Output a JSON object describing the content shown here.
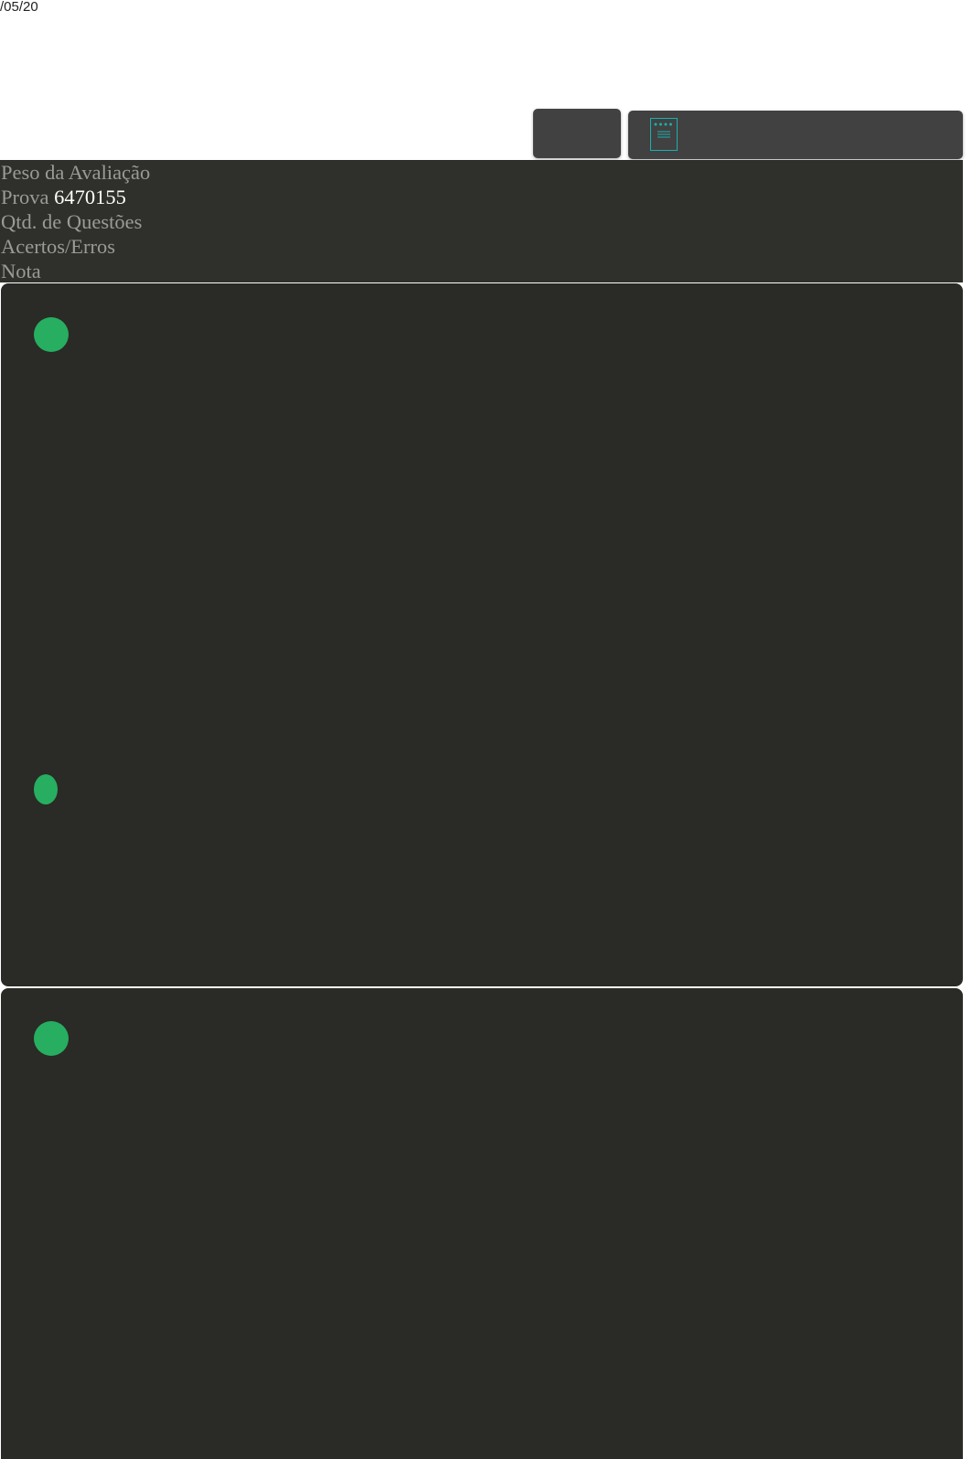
{
  "header": {
    "date_fragment": "/05/20"
  },
  "info": {
    "peso_label": "Peso da Avaliação",
    "prova_label": "Prova",
    "prova_value": "6470155",
    "qtd_label": "Qtd. de Questões",
    "acertos_label": "Acertos/Erros",
    "nota_label": "Nota"
  },
  "icons": {
    "document": "document-icon",
    "status": "check-circle-icon"
  },
  "colors": {
    "background": "#ffffff",
    "panel": "#414141",
    "info_block": "#2f2f2b",
    "card": "#2a2a26",
    "label_text": "#9a9a96",
    "value_text": "#ffffff",
    "status_green": "#27ae60",
    "icon_teal": "#1ab0b0"
  }
}
